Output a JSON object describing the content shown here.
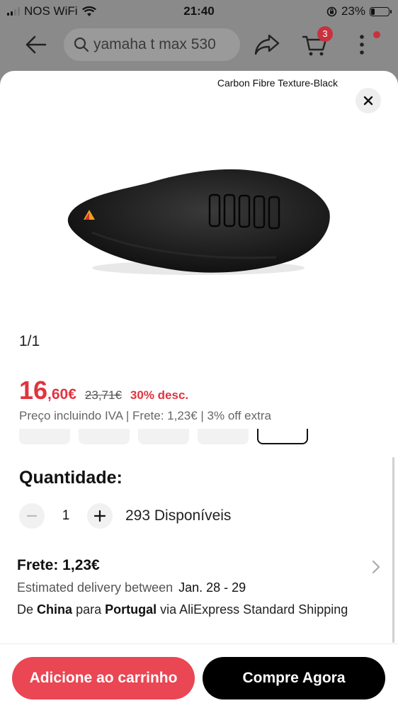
{
  "status_bar": {
    "carrier": "NOS WiFi",
    "time": "21:40",
    "battery": "23%",
    "battery_level": 0.23
  },
  "header": {
    "search_text": "yamaha t max 530",
    "cart_count": "3",
    "icons": [
      "back-arrow-icon",
      "search-icon",
      "share-icon",
      "cart-icon",
      "more-icon"
    ]
  },
  "sheet": {
    "variant_name": "Carbon Fibre Texture-Black",
    "image_index": "1/1",
    "price": {
      "integer": "16",
      "decimal": ",60€",
      "original": "23,71€",
      "discount": "30% desc."
    },
    "price_note": "Preço incluindo IVA | Frete: 1,23€ | 3% off extra",
    "quantity": {
      "title": "Quantidade:",
      "value": "1",
      "available": "293 Disponíveis"
    },
    "shipping": {
      "title": "Frete: 1,23€",
      "estimate_label": "Estimated delivery between",
      "estimate_dates": "Jan. 28 - 29",
      "route_prefix": "De",
      "route_from": "China",
      "route_mid": "para",
      "route_to": "Portugal",
      "route_suffix": "via AliExpress Standard Shipping"
    }
  },
  "actions": {
    "add_to_cart": "Adicione ao carrinho",
    "buy_now": "Compre Agora"
  },
  "colors": {
    "accent_red": "#e1333f",
    "cart_button": "#ea4653",
    "buy_button": "#000000"
  }
}
